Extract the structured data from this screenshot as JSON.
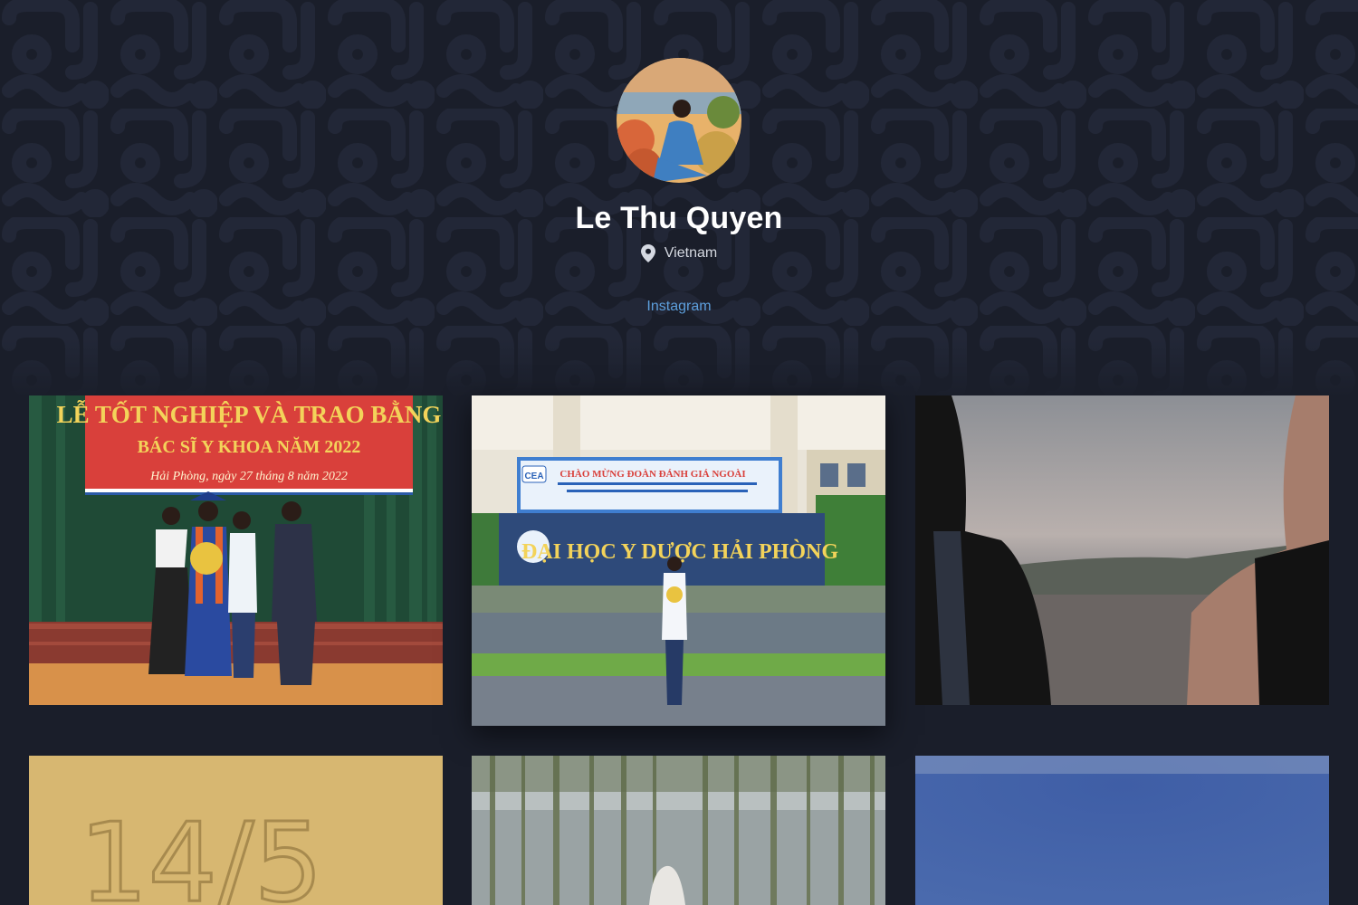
{
  "profile": {
    "name": "Le Thu Quyen",
    "location": "Vietnam",
    "link_label": "Instagram",
    "avatar_icon": "avatar-photo"
  },
  "gallery": {
    "photos": [
      {
        "name": "photo-graduation-ceremony",
        "banner_line1": "LỄ TỐT NGHIỆP VÀ TRAO BẰNG",
        "banner_line2": "BÁC SĨ Y KHOA NĂM 2022",
        "banner_line3": "Hải Phòng, ngày 27 tháng 8 năm 2022"
      },
      {
        "name": "photo-university-sign",
        "banner_line1": "CHÀO MỪNG ĐOÀN ĐÁNH GIÁ NGOÀI",
        "banner_line2": "ĐẠI HỌC Y DƯỢC HẢI PHÒNG",
        "badge": "CEA"
      },
      {
        "name": "photo-beach-dusk"
      },
      {
        "name": "photo-sand-writing",
        "sand_text": "14/5"
      },
      {
        "name": "photo-bamboo-forest"
      },
      {
        "name": "photo-blue-sky"
      }
    ]
  },
  "colors": {
    "background": "#1a1e2a",
    "link": "#5d9fdd",
    "banner_red": "#d9403b",
    "banner_yellow": "#f3d35a"
  }
}
